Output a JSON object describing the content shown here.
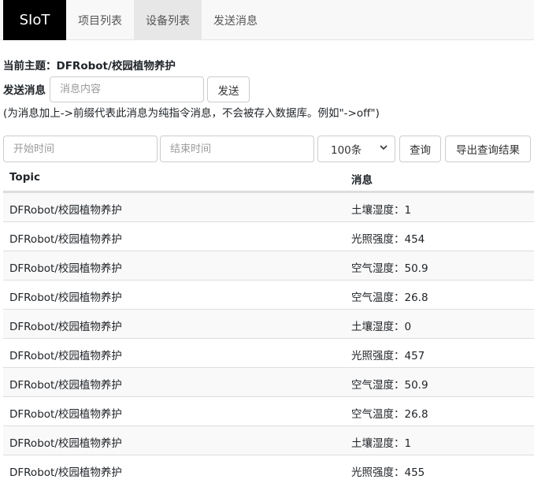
{
  "navbar": {
    "brand": "SIoT",
    "items": [
      {
        "label": "项目列表"
      },
      {
        "label": "设备列表"
      },
      {
        "label": "发送消息"
      }
    ]
  },
  "topic": {
    "text": "当前主题：DFRobot/校园植物养护"
  },
  "send": {
    "label": "发送消息",
    "placeholder": "消息内容",
    "button": "发送",
    "hint": "(为消息加上->前缀代表此消息为纯指令消息，不会被存入数据库。例如\"->off\")"
  },
  "query": {
    "start_placeholder": "开始时间",
    "end_placeholder": "结束时间",
    "count_selected": "100条",
    "query_button": "查询",
    "export_button": "导出查询结果"
  },
  "table": {
    "headers": {
      "topic": "Topic",
      "message": "消息"
    },
    "rows": [
      {
        "topic": "DFRobot/校园植物养护",
        "message": "土壤湿度：1"
      },
      {
        "topic": "DFRobot/校园植物养护",
        "message": "光照强度：454"
      },
      {
        "topic": "DFRobot/校园植物养护",
        "message": "空气湿度：50.9"
      },
      {
        "topic": "DFRobot/校园植物养护",
        "message": "空气温度：26.8"
      },
      {
        "topic": "DFRobot/校园植物养护",
        "message": "土壤湿度：0"
      },
      {
        "topic": "DFRobot/校园植物养护",
        "message": "光照强度：457"
      },
      {
        "topic": "DFRobot/校园植物养护",
        "message": "空气湿度：50.9"
      },
      {
        "topic": "DFRobot/校园植物养护",
        "message": "空气温度：26.8"
      },
      {
        "topic": "DFRobot/校园植物养护",
        "message": "土壤湿度：1"
      },
      {
        "topic": "DFRobot/校园植物养护",
        "message": "光照强度：455"
      }
    ]
  }
}
